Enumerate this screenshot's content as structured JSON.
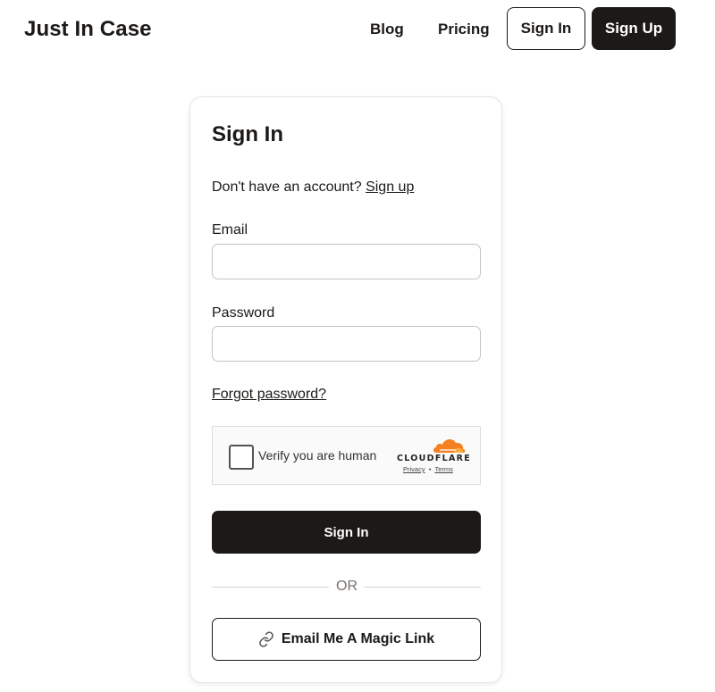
{
  "header": {
    "brand": "Just In Case",
    "nav": {
      "blog": "Blog",
      "pricing": "Pricing"
    },
    "sign_in": "Sign In",
    "sign_up": "Sign Up"
  },
  "form": {
    "title": "Sign In",
    "no_account_text": "Don't have an account?",
    "sign_up_link": "Sign up",
    "email_label": "Email",
    "email_value": "",
    "password_label": "Password",
    "password_value": "",
    "forgot_password": "Forgot password?",
    "captcha": {
      "text": "Verify you are human",
      "brand": "CLOUDFLARE",
      "privacy": "Privacy",
      "separator": "•",
      "terms": "Terms"
    },
    "submit": "Sign In",
    "divider": "OR",
    "magic_link": "Email Me A Magic Link"
  },
  "icons": {
    "magic_link": "link-icon",
    "captcha_logo": "cloudflare-cloud-icon"
  },
  "colors": {
    "primary": "#1c1917",
    "cloudflare_orange": "#f48120"
  }
}
